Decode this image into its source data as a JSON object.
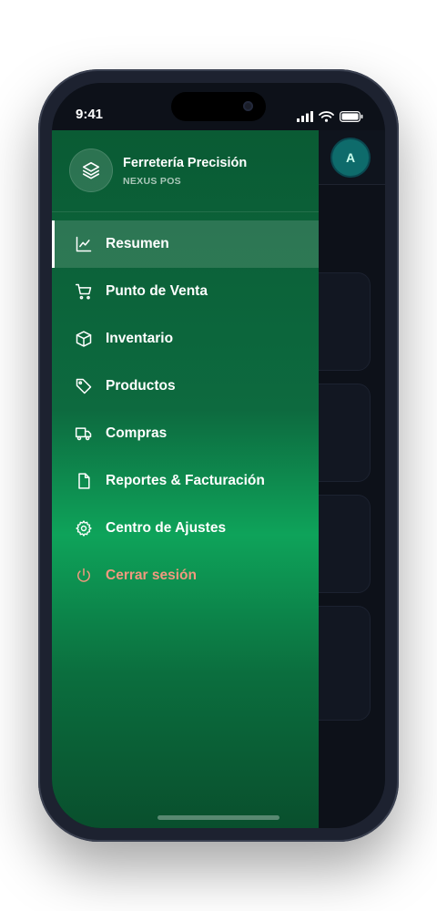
{
  "status_bar": {
    "time": "9:41"
  },
  "header": {
    "avatar_initial": "A"
  },
  "drawer": {
    "brand": {
      "name": "Ferretería Precisión",
      "subtitle": "NEXUS POS",
      "icon": "layers-icon"
    },
    "items": [
      {
        "label": "Resumen",
        "icon": "chart-icon",
        "active": true
      },
      {
        "label": "Punto de Venta",
        "icon": "cart-icon"
      },
      {
        "label": "Inventario",
        "icon": "box-icon"
      },
      {
        "label": "Productos",
        "icon": "tag-icon"
      },
      {
        "label": "Compras",
        "icon": "truck-icon"
      },
      {
        "label": "Reportes & Facturación",
        "icon": "file-icon"
      },
      {
        "label": "Centro de Ajustes",
        "icon": "gear-icon"
      },
      {
        "label": "Cerrar sesión",
        "icon": "power-icon",
        "danger": true
      }
    ]
  },
  "colors": {
    "accent": "#0ea35a",
    "danger": "#f2997f",
    "avatar": "#0e6b6b"
  }
}
